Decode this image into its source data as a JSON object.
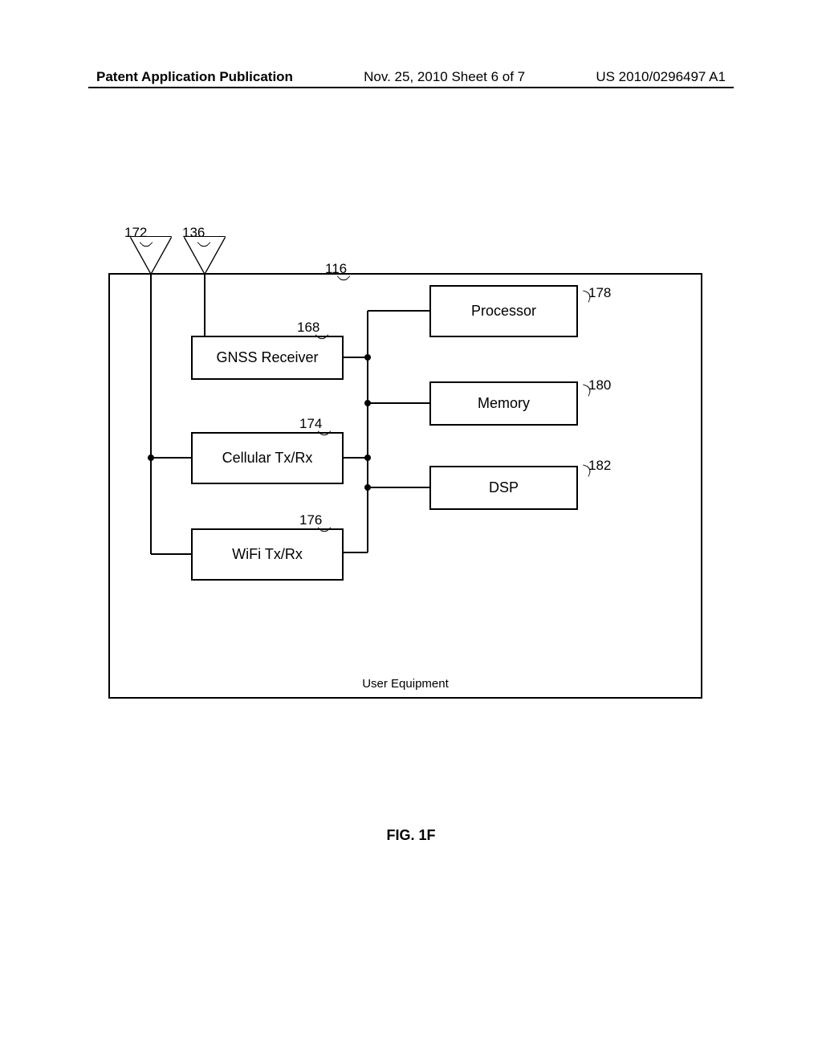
{
  "header": {
    "left": "Patent Application Publication",
    "center": "Nov. 25, 2010  Sheet 6 of 7",
    "right": "US 2010/0296497 A1"
  },
  "labels": {
    "l172": "172",
    "l136": "136",
    "l116": "116",
    "l168": "168",
    "l174": "174",
    "l176": "176",
    "l178": "178",
    "l180": "180",
    "l182": "182"
  },
  "components": {
    "gnss": "GNSS Receiver",
    "cellular": "Cellular Tx/Rx",
    "wifi": "WiFi Tx/Rx",
    "processor": "Processor",
    "memory": "Memory",
    "dsp": "DSP",
    "mainbox": "User Equipment"
  },
  "figure": "FIG. 1F"
}
